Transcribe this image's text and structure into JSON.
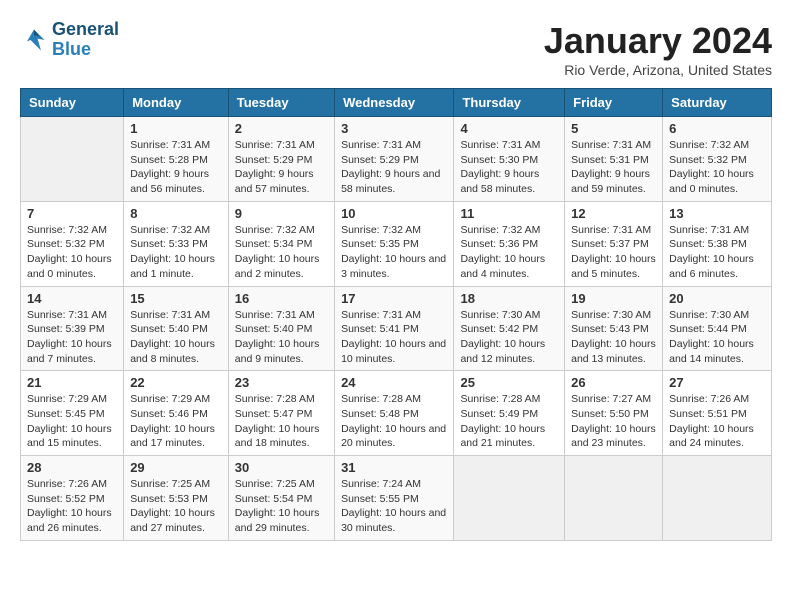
{
  "header": {
    "logo_line1": "General",
    "logo_line2": "Blue",
    "title": "January 2024",
    "subtitle": "Rio Verde, Arizona, United States"
  },
  "days_of_week": [
    "Sunday",
    "Monday",
    "Tuesday",
    "Wednesday",
    "Thursday",
    "Friday",
    "Saturday"
  ],
  "weeks": [
    [
      {
        "num": "",
        "empty": true
      },
      {
        "num": "1",
        "sunrise": "7:31 AM",
        "sunset": "5:28 PM",
        "daylight": "9 hours and 56 minutes."
      },
      {
        "num": "2",
        "sunrise": "7:31 AM",
        "sunset": "5:29 PM",
        "daylight": "9 hours and 57 minutes."
      },
      {
        "num": "3",
        "sunrise": "7:31 AM",
        "sunset": "5:29 PM",
        "daylight": "9 hours and 58 minutes."
      },
      {
        "num": "4",
        "sunrise": "7:31 AM",
        "sunset": "5:30 PM",
        "daylight": "9 hours and 58 minutes."
      },
      {
        "num": "5",
        "sunrise": "7:31 AM",
        "sunset": "5:31 PM",
        "daylight": "9 hours and 59 minutes."
      },
      {
        "num": "6",
        "sunrise": "7:32 AM",
        "sunset": "5:32 PM",
        "daylight": "10 hours and 0 minutes."
      }
    ],
    [
      {
        "num": "7",
        "sunrise": "7:32 AM",
        "sunset": "5:32 PM",
        "daylight": "10 hours and 0 minutes."
      },
      {
        "num": "8",
        "sunrise": "7:32 AM",
        "sunset": "5:33 PM",
        "daylight": "10 hours and 1 minute."
      },
      {
        "num": "9",
        "sunrise": "7:32 AM",
        "sunset": "5:34 PM",
        "daylight": "10 hours and 2 minutes."
      },
      {
        "num": "10",
        "sunrise": "7:32 AM",
        "sunset": "5:35 PM",
        "daylight": "10 hours and 3 minutes."
      },
      {
        "num": "11",
        "sunrise": "7:32 AM",
        "sunset": "5:36 PM",
        "daylight": "10 hours and 4 minutes."
      },
      {
        "num": "12",
        "sunrise": "7:31 AM",
        "sunset": "5:37 PM",
        "daylight": "10 hours and 5 minutes."
      },
      {
        "num": "13",
        "sunrise": "7:31 AM",
        "sunset": "5:38 PM",
        "daylight": "10 hours and 6 minutes."
      }
    ],
    [
      {
        "num": "14",
        "sunrise": "7:31 AM",
        "sunset": "5:39 PM",
        "daylight": "10 hours and 7 minutes."
      },
      {
        "num": "15",
        "sunrise": "7:31 AM",
        "sunset": "5:40 PM",
        "daylight": "10 hours and 8 minutes."
      },
      {
        "num": "16",
        "sunrise": "7:31 AM",
        "sunset": "5:40 PM",
        "daylight": "10 hours and 9 minutes."
      },
      {
        "num": "17",
        "sunrise": "7:31 AM",
        "sunset": "5:41 PM",
        "daylight": "10 hours and 10 minutes."
      },
      {
        "num": "18",
        "sunrise": "7:30 AM",
        "sunset": "5:42 PM",
        "daylight": "10 hours and 12 minutes."
      },
      {
        "num": "19",
        "sunrise": "7:30 AM",
        "sunset": "5:43 PM",
        "daylight": "10 hours and 13 minutes."
      },
      {
        "num": "20",
        "sunrise": "7:30 AM",
        "sunset": "5:44 PM",
        "daylight": "10 hours and 14 minutes."
      }
    ],
    [
      {
        "num": "21",
        "sunrise": "7:29 AM",
        "sunset": "5:45 PM",
        "daylight": "10 hours and 15 minutes."
      },
      {
        "num": "22",
        "sunrise": "7:29 AM",
        "sunset": "5:46 PM",
        "daylight": "10 hours and 17 minutes."
      },
      {
        "num": "23",
        "sunrise": "7:28 AM",
        "sunset": "5:47 PM",
        "daylight": "10 hours and 18 minutes."
      },
      {
        "num": "24",
        "sunrise": "7:28 AM",
        "sunset": "5:48 PM",
        "daylight": "10 hours and 20 minutes."
      },
      {
        "num": "25",
        "sunrise": "7:28 AM",
        "sunset": "5:49 PM",
        "daylight": "10 hours and 21 minutes."
      },
      {
        "num": "26",
        "sunrise": "7:27 AM",
        "sunset": "5:50 PM",
        "daylight": "10 hours and 23 minutes."
      },
      {
        "num": "27",
        "sunrise": "7:26 AM",
        "sunset": "5:51 PM",
        "daylight": "10 hours and 24 minutes."
      }
    ],
    [
      {
        "num": "28",
        "sunrise": "7:26 AM",
        "sunset": "5:52 PM",
        "daylight": "10 hours and 26 minutes."
      },
      {
        "num": "29",
        "sunrise": "7:25 AM",
        "sunset": "5:53 PM",
        "daylight": "10 hours and 27 minutes."
      },
      {
        "num": "30",
        "sunrise": "7:25 AM",
        "sunset": "5:54 PM",
        "daylight": "10 hours and 29 minutes."
      },
      {
        "num": "31",
        "sunrise": "7:24 AM",
        "sunset": "5:55 PM",
        "daylight": "10 hours and 30 minutes."
      },
      {
        "num": "",
        "empty": true
      },
      {
        "num": "",
        "empty": true
      },
      {
        "num": "",
        "empty": true
      }
    ]
  ],
  "labels": {
    "sunrise": "Sunrise:",
    "sunset": "Sunset:",
    "daylight": "Daylight:"
  }
}
